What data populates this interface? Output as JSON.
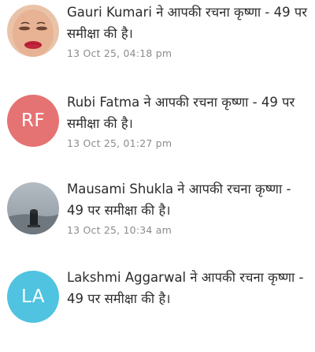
{
  "notifications": [
    {
      "name": "Gauri Kumari",
      "text": " ने आपकी रचना कृष्णा - 49 पर समीक्षा की है।",
      "time": "13 Oct 25, 04:18 pm",
      "avatar_type": "photo-face"
    },
    {
      "name": "Rubi Fatma",
      "text": " ने आपकी रचना कृष्णा - 49 पर समीक्षा की है।",
      "time": "13 Oct 25, 01:27 pm",
      "avatar_type": "initials",
      "initials": "RF",
      "avatar_color": "#e57373"
    },
    {
      "name": "Mausami Shukla",
      "text": " ने आपकी रचना कृष्णा - 49 पर समीक्षा की है।",
      "time": "13 Oct 25, 10:34 am",
      "avatar_type": "photo-landscape"
    },
    {
      "name": "Lakshmi Aggarwal",
      "text": " ने आपकी रचना कृष्णा - 49 पर समीक्षा की है।",
      "time": "",
      "avatar_type": "initials",
      "initials": "LA",
      "avatar_color": "#4fc3e0"
    }
  ]
}
